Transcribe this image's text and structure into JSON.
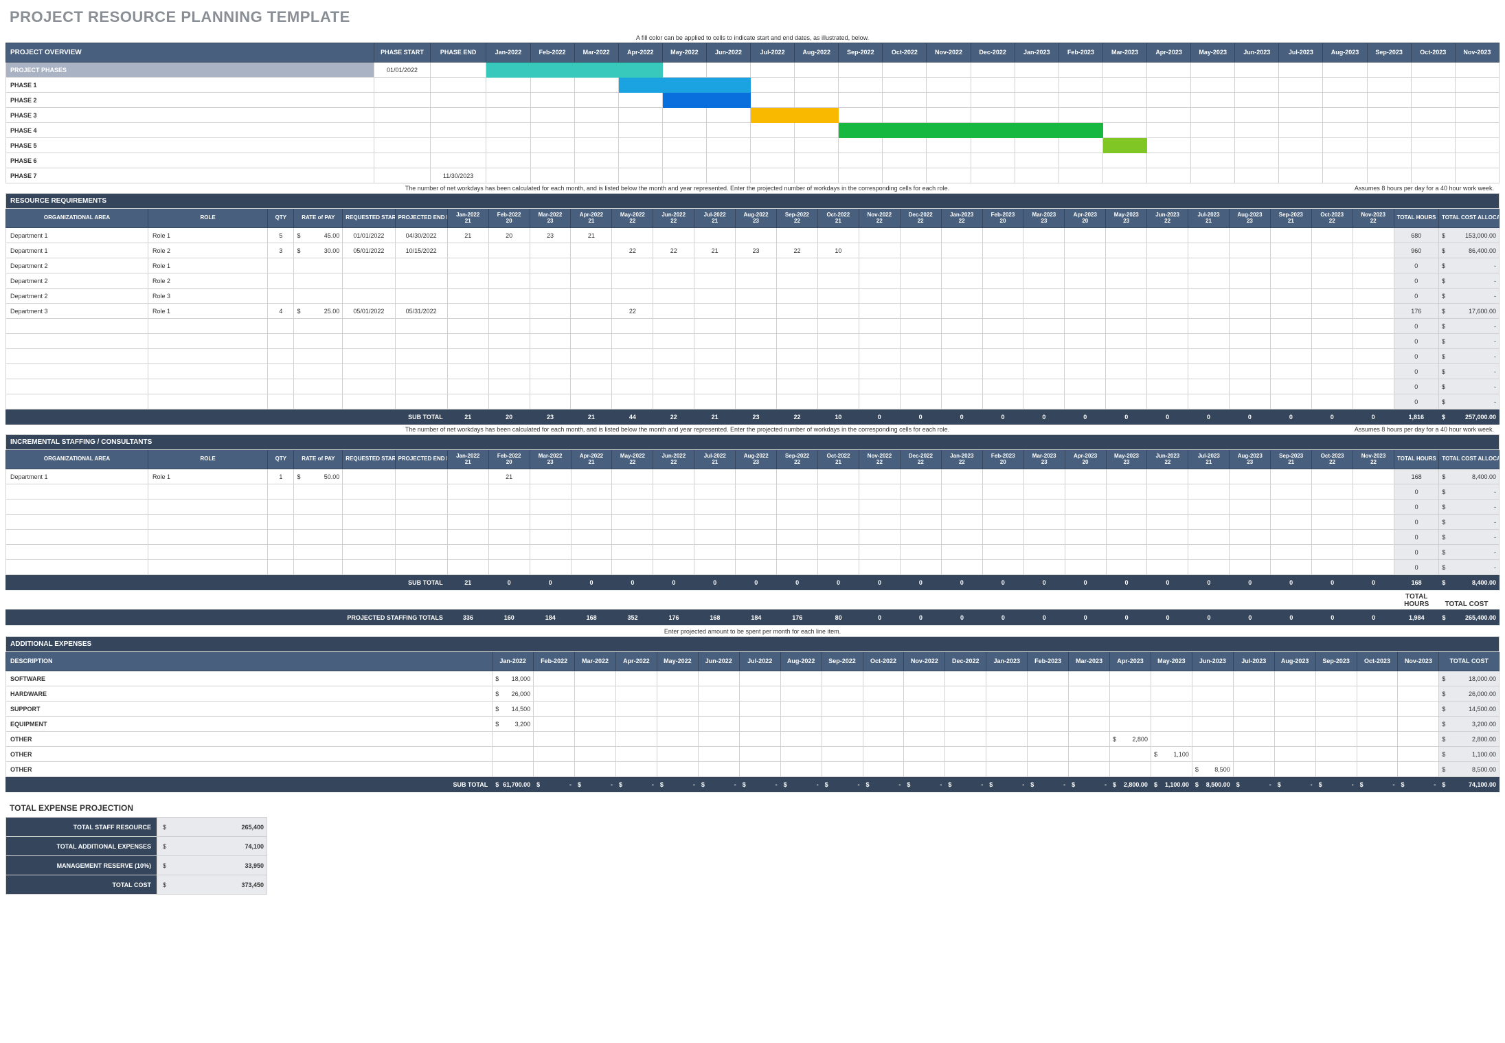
{
  "title": "PROJECT RESOURCE PLANNING TEMPLATE",
  "months": [
    "Jan-2022",
    "Feb-2022",
    "Mar-2022",
    "Apr-2022",
    "May-2022",
    "Jun-2022",
    "Jul-2022",
    "Aug-2022",
    "Sep-2022",
    "Oct-2022",
    "Nov-2022",
    "Dec-2022",
    "Jan-2023",
    "Feb-2023",
    "Mar-2023",
    "Apr-2023",
    "May-2023",
    "Jun-2023",
    "Jul-2023",
    "Aug-2023",
    "Sep-2023",
    "Oct-2023",
    "Nov-2023"
  ],
  "workdays": [
    "21",
    "20",
    "23",
    "21",
    "22",
    "22",
    "21",
    "23",
    "22",
    "21",
    "22",
    "22",
    "22",
    "20",
    "23",
    "20",
    "23",
    "22",
    "21",
    "23",
    "21",
    "22",
    "22"
  ],
  "overview": {
    "note": "A fill color can be applied to cells to indicate start and end dates, as illustrated, below.",
    "section": "PROJECT OVERVIEW",
    "col_phase_start": "PHASE START",
    "col_phase_end": "PHASE END",
    "phases_label": "PROJECT PHASES",
    "phases_start": "01/01/2022",
    "rows": [
      {
        "name": "PHASE 1",
        "start": "",
        "end": "",
        "bar_start": 3,
        "bar_end": 5,
        "color": "#1ba2e0"
      },
      {
        "name": "PHASE 2",
        "start": "",
        "end": "",
        "bar_start": 4,
        "bar_end": 5,
        "color": "#096fdd"
      },
      {
        "name": "PHASE 3",
        "start": "",
        "end": "",
        "bar_start": 6,
        "bar_end": 7,
        "color": "#f9b900"
      },
      {
        "name": "PHASE 4",
        "start": "",
        "end": "",
        "bar_start": 8,
        "bar_end": 13,
        "color": "#17b83f"
      },
      {
        "name": "PHASE 5",
        "start": "",
        "end": "",
        "bar_start": 14,
        "bar_end": 14,
        "color": "#80c624"
      },
      {
        "name": "PHASE 6",
        "start": "",
        "end": "",
        "bar_start": -1,
        "bar_end": -1,
        "color": ""
      },
      {
        "name": "PHASE 7",
        "start": "",
        "end": "11/30/2023",
        "bar_start": -1,
        "bar_end": -1,
        "color": ""
      }
    ],
    "phases_bar": {
      "start": 0,
      "end": 3,
      "color": "#38c8bc"
    }
  },
  "resources": {
    "section": "RESOURCE REQUIREMENTS",
    "note_left": "The number of net workdays has been calculated for each month, and is listed below the month and year represented. Enter the projected number of workdays in the corresponding cells for each role.",
    "note_right": "Assumes 8 hours per day for a 40 hour work week.",
    "cols": {
      "org": "ORGANIZATIONAL AREA",
      "role": "ROLE",
      "qty": "QTY",
      "rate": "RATE of PAY",
      "req_start": "REQUESTED START DATE",
      "proj_end": "PROJECTED END DATE",
      "total_hours": "TOTAL HOURS",
      "total_cost": "TOTAL COST ALLOCATED"
    },
    "rows": [
      {
        "org": "Department 1",
        "role": "Role 1",
        "qty": "5",
        "rate": "45.00",
        "req": "01/01/2022",
        "end": "04/30/2022",
        "vals": [
          "21",
          "20",
          "23",
          "21",
          "",
          "",
          "",
          "",
          "",
          "",
          "",
          "",
          "",
          "",
          "",
          "",
          "",
          "",
          "",
          "",
          "",
          "",
          ""
        ],
        "hours": "680",
        "cost": "153,000.00"
      },
      {
        "org": "Department 1",
        "role": "Role 2",
        "qty": "3",
        "rate": "30.00",
        "req": "05/01/2022",
        "end": "10/15/2022",
        "vals": [
          "",
          "",
          "",
          "",
          "22",
          "22",
          "21",
          "23",
          "22",
          "10",
          "",
          "",
          "",
          "",
          "",
          "",
          "",
          "",
          "",
          "",
          "",
          "",
          ""
        ],
        "hours": "960",
        "cost": "86,400.00"
      },
      {
        "org": "Department 2",
        "role": "Role 1",
        "qty": "",
        "rate": "",
        "req": "",
        "end": "",
        "vals": [
          "",
          "",
          "",
          "",
          "",
          "",
          "",
          "",
          "",
          "",
          "",
          "",
          "",
          "",
          "",
          "",
          "",
          "",
          "",
          "",
          "",
          "",
          ""
        ],
        "hours": "0",
        "cost": "-"
      },
      {
        "org": "Department 2",
        "role": "Role 2",
        "qty": "",
        "rate": "",
        "req": "",
        "end": "",
        "vals": [
          "",
          "",
          "",
          "",
          "",
          "",
          "",
          "",
          "",
          "",
          "",
          "",
          "",
          "",
          "",
          "",
          "",
          "",
          "",
          "",
          "",
          "",
          ""
        ],
        "hours": "0",
        "cost": "-"
      },
      {
        "org": "Department 2",
        "role": "Role 3",
        "qty": "",
        "rate": "",
        "req": "",
        "end": "",
        "vals": [
          "",
          "",
          "",
          "",
          "",
          "",
          "",
          "",
          "",
          "",
          "",
          "",
          "",
          "",
          "",
          "",
          "",
          "",
          "",
          "",
          "",
          "",
          ""
        ],
        "hours": "0",
        "cost": "-"
      },
      {
        "org": "Department 3",
        "role": "Role 1",
        "qty": "4",
        "rate": "25.00",
        "req": "05/01/2022",
        "end": "05/31/2022",
        "vals": [
          "",
          "",
          "",
          "",
          "22",
          "",
          "",
          "",
          "",
          "",
          "",
          "",
          "",
          "",
          "",
          "",
          "",
          "",
          "",
          "",
          "",
          "",
          ""
        ],
        "hours": "176",
        "cost": "17,600.00"
      },
      {
        "org": "",
        "role": "",
        "qty": "",
        "rate": "",
        "req": "",
        "end": "",
        "vals": [
          "",
          "",
          "",
          "",
          "",
          "",
          "",
          "",
          "",
          "",
          "",
          "",
          "",
          "",
          "",
          "",
          "",
          "",
          "",
          "",
          "",
          "",
          ""
        ],
        "hours": "0",
        "cost": "-"
      },
      {
        "org": "",
        "role": "",
        "qty": "",
        "rate": "",
        "req": "",
        "end": "",
        "vals": [
          "",
          "",
          "",
          "",
          "",
          "",
          "",
          "",
          "",
          "",
          "",
          "",
          "",
          "",
          "",
          "",
          "",
          "",
          "",
          "",
          "",
          "",
          ""
        ],
        "hours": "0",
        "cost": "-"
      },
      {
        "org": "",
        "role": "",
        "qty": "",
        "rate": "",
        "req": "",
        "end": "",
        "vals": [
          "",
          "",
          "",
          "",
          "",
          "",
          "",
          "",
          "",
          "",
          "",
          "",
          "",
          "",
          "",
          "",
          "",
          "",
          "",
          "",
          "",
          "",
          ""
        ],
        "hours": "0",
        "cost": "-"
      },
      {
        "org": "",
        "role": "",
        "qty": "",
        "rate": "",
        "req": "",
        "end": "",
        "vals": [
          "",
          "",
          "",
          "",
          "",
          "",
          "",
          "",
          "",
          "",
          "",
          "",
          "",
          "",
          "",
          "",
          "",
          "",
          "",
          "",
          "",
          "",
          ""
        ],
        "hours": "0",
        "cost": "-"
      },
      {
        "org": "",
        "role": "",
        "qty": "",
        "rate": "",
        "req": "",
        "end": "",
        "vals": [
          "",
          "",
          "",
          "",
          "",
          "",
          "",
          "",
          "",
          "",
          "",
          "",
          "",
          "",
          "",
          "",
          "",
          "",
          "",
          "",
          "",
          "",
          ""
        ],
        "hours": "0",
        "cost": "-"
      },
      {
        "org": "",
        "role": "",
        "qty": "",
        "rate": "",
        "req": "",
        "end": "",
        "vals": [
          "",
          "",
          "",
          "",
          "",
          "",
          "",
          "",
          "",
          "",
          "",
          "",
          "",
          "",
          "",
          "",
          "",
          "",
          "",
          "",
          "",
          "",
          ""
        ],
        "hours": "0",
        "cost": "-"
      }
    ],
    "subtotal_label": "SUB TOTAL",
    "subtotal_vals": [
      "21",
      "20",
      "23",
      "21",
      "44",
      "22",
      "21",
      "23",
      "22",
      "10",
      "0",
      "0",
      "0",
      "0",
      "0",
      "0",
      "0",
      "0",
      "0",
      "0",
      "0",
      "0",
      "0"
    ],
    "subtotal_hours": "1,816",
    "subtotal_cost": "257,000.00"
  },
  "incremental": {
    "section": "INCREMENTAL STAFFING / CONSULTANTS",
    "rows": [
      {
        "org": "Department 1",
        "role": "Role 1",
        "qty": "1",
        "rate": "50.00",
        "req": "",
        "end": "",
        "vals": [
          "",
          "21",
          "",
          "",
          "",
          "",
          "",
          "",
          "",
          "",
          "",
          "",
          "",
          "",
          "",
          "",
          "",
          "",
          "",
          "",
          "",
          "",
          ""
        ],
        "hours": "168",
        "cost": "8,400.00"
      },
      {
        "org": "",
        "role": "",
        "qty": "",
        "rate": "",
        "req": "",
        "end": "",
        "vals": [
          "",
          "",
          "",
          "",
          "",
          "",
          "",
          "",
          "",
          "",
          "",
          "",
          "",
          "",
          "",
          "",
          "",
          "",
          "",
          "",
          "",
          "",
          ""
        ],
        "hours": "0",
        "cost": "-"
      },
      {
        "org": "",
        "role": "",
        "qty": "",
        "rate": "",
        "req": "",
        "end": "",
        "vals": [
          "",
          "",
          "",
          "",
          "",
          "",
          "",
          "",
          "",
          "",
          "",
          "",
          "",
          "",
          "",
          "",
          "",
          "",
          "",
          "",
          "",
          "",
          ""
        ],
        "hours": "0",
        "cost": "-"
      },
      {
        "org": "",
        "role": "",
        "qty": "",
        "rate": "",
        "req": "",
        "end": "",
        "vals": [
          "",
          "",
          "",
          "",
          "",
          "",
          "",
          "",
          "",
          "",
          "",
          "",
          "",
          "",
          "",
          "",
          "",
          "",
          "",
          "",
          "",
          "",
          ""
        ],
        "hours": "0",
        "cost": "-"
      },
      {
        "org": "",
        "role": "",
        "qty": "",
        "rate": "",
        "req": "",
        "end": "",
        "vals": [
          "",
          "",
          "",
          "",
          "",
          "",
          "",
          "",
          "",
          "",
          "",
          "",
          "",
          "",
          "",
          "",
          "",
          "",
          "",
          "",
          "",
          "",
          ""
        ],
        "hours": "0",
        "cost": "-"
      },
      {
        "org": "",
        "role": "",
        "qty": "",
        "rate": "",
        "req": "",
        "end": "",
        "vals": [
          "",
          "",
          "",
          "",
          "",
          "",
          "",
          "",
          "",
          "",
          "",
          "",
          "",
          "",
          "",
          "",
          "",
          "",
          "",
          "",
          "",
          "",
          ""
        ],
        "hours": "0",
        "cost": "-"
      },
      {
        "org": "",
        "role": "",
        "qty": "",
        "rate": "",
        "req": "",
        "end": "",
        "vals": [
          "",
          "",
          "",
          "",
          "",
          "",
          "",
          "",
          "",
          "",
          "",
          "",
          "",
          "",
          "",
          "",
          "",
          "",
          "",
          "",
          "",
          "",
          ""
        ],
        "hours": "0",
        "cost": "-"
      }
    ],
    "subtotal_vals": [
      "21",
      "0",
      "0",
      "0",
      "0",
      "0",
      "0",
      "0",
      "0",
      "0",
      "0",
      "0",
      "0",
      "0",
      "0",
      "0",
      "0",
      "0",
      "0",
      "0",
      "0",
      "0",
      "0"
    ],
    "subtotal_hours": "168",
    "subtotal_cost": "8,400.00"
  },
  "staffing_totals": {
    "label_hours": "TOTAL HOURS",
    "label_cost": "TOTAL COST",
    "row_label": "PROJECTED STAFFING TOTALS",
    "vals": [
      "336",
      "160",
      "184",
      "168",
      "352",
      "176",
      "168",
      "184",
      "176",
      "80",
      "0",
      "0",
      "0",
      "0",
      "0",
      "0",
      "0",
      "0",
      "0",
      "0",
      "0",
      "0",
      "0"
    ],
    "hours": "1,984",
    "cost": "265,400.00"
  },
  "expenses": {
    "section": "ADDITIONAL EXPENSES",
    "note": "Enter projected amount to be spent per month for each line item.",
    "desc_col": "DESCRIPTION",
    "total_col": "TOTAL COST",
    "rows": [
      {
        "desc": "SOFTWARE",
        "vals": [
          "18,000",
          "",
          "",
          "",
          "",
          "",
          "",
          "",
          "",
          "",
          "",
          "",
          "",
          "",
          "",
          "",
          "",
          "",
          "",
          "",
          "",
          "",
          ""
        ],
        "total": "18,000.00"
      },
      {
        "desc": "HARDWARE",
        "vals": [
          "26,000",
          "",
          "",
          "",
          "",
          "",
          "",
          "",
          "",
          "",
          "",
          "",
          "",
          "",
          "",
          "",
          "",
          "",
          "",
          "",
          "",
          "",
          ""
        ],
        "total": "26,000.00"
      },
      {
        "desc": "SUPPORT",
        "vals": [
          "14,500",
          "",
          "",
          "",
          "",
          "",
          "",
          "",
          "",
          "",
          "",
          "",
          "",
          "",
          "",
          "",
          "",
          "",
          "",
          "",
          "",
          "",
          ""
        ],
        "total": "14,500.00"
      },
      {
        "desc": "EQUIPMENT",
        "vals": [
          "3,200",
          "",
          "",
          "",
          "",
          "",
          "",
          "",
          "",
          "",
          "",
          "",
          "",
          "",
          "",
          "",
          "",
          "",
          "",
          "",
          "",
          "",
          ""
        ],
        "total": "3,200.00"
      },
      {
        "desc": "OTHER",
        "vals": [
          "",
          "",
          "",
          "",
          "",
          "",
          "",
          "",
          "",
          "",
          "",
          "",
          "",
          "",
          "",
          "2,800",
          "",
          "",
          "",
          "",
          "",
          "",
          ""
        ],
        "total": "2,800.00"
      },
      {
        "desc": "OTHER",
        "vals": [
          "",
          "",
          "",
          "",
          "",
          "",
          "",
          "",
          "",
          "",
          "",
          "",
          "",
          "",
          "",
          "",
          "1,100",
          "",
          "",
          "",
          "",
          "",
          ""
        ],
        "total": "1,100.00"
      },
      {
        "desc": "OTHER",
        "vals": [
          "",
          "",
          "",
          "",
          "",
          "",
          "",
          "",
          "",
          "",
          "",
          "",
          "",
          "",
          "",
          "",
          "",
          "8,500",
          "",
          "",
          "",
          "",
          ""
        ],
        "total": "8,500.00"
      }
    ],
    "subtotal_vals": [
      "61,700.00",
      "-",
      "-",
      "-",
      "-",
      "-",
      "-",
      "-",
      "-",
      "-",
      "-",
      "-",
      "-",
      "-",
      "-",
      "2,800.00",
      "1,100.00",
      "8,500.00",
      "-",
      "-",
      "-",
      "-",
      "-"
    ],
    "subtotal_total": "74,100.00"
  },
  "summary": {
    "title": "TOTAL EXPENSE PROJECTION",
    "rows": [
      {
        "label": "TOTAL STAFF RESOURCE",
        "val": "265,400"
      },
      {
        "label": "TOTAL ADDITIONAL EXPENSES",
        "val": "74,100"
      },
      {
        "label": "MANAGEMENT RESERVE (10%)",
        "val": "33,950"
      },
      {
        "label": "TOTAL COST",
        "val": "373,450"
      }
    ]
  }
}
